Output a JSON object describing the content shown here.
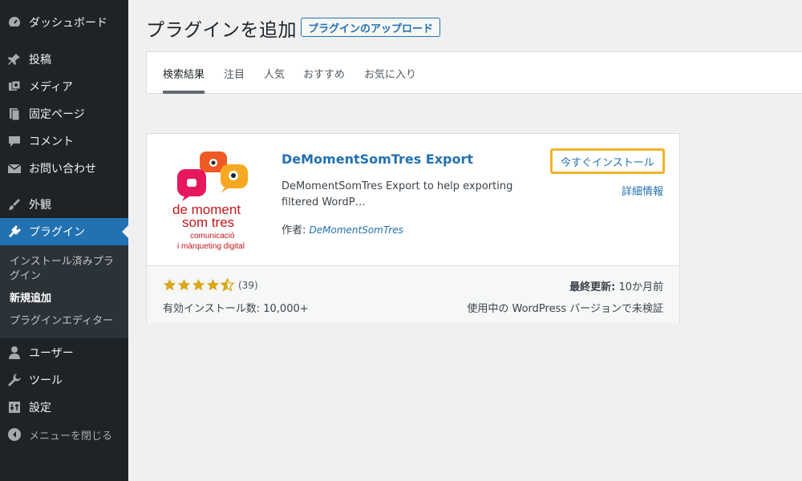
{
  "sidebar": {
    "items": [
      {
        "label": "ダッシュボード",
        "icon": "dashboard-icon"
      },
      {
        "label": "投稿",
        "icon": "pin-icon"
      },
      {
        "label": "メディア",
        "icon": "media-icon"
      },
      {
        "label": "固定ページ",
        "icon": "pages-icon"
      },
      {
        "label": "コメント",
        "icon": "comment-icon"
      },
      {
        "label": "お問い合わせ",
        "icon": "mail-icon"
      },
      {
        "label": "外観",
        "icon": "appearance-icon"
      },
      {
        "label": "プラグイン",
        "icon": "plugin-icon"
      },
      {
        "label": "ユーザー",
        "icon": "user-icon"
      },
      {
        "label": "ツール",
        "icon": "wrench-icon"
      },
      {
        "label": "設定",
        "icon": "settings-icon"
      }
    ],
    "submenu": [
      {
        "label": "インストール済みプラグイン"
      },
      {
        "label": "新規追加"
      },
      {
        "label": "プラグインエディター"
      }
    ],
    "collapse_label": "メニューを閉じる"
  },
  "header": {
    "title": "プラグインを追加",
    "upload_label": "プラグインのアップロード"
  },
  "tabs": [
    {
      "label": "検索結果"
    },
    {
      "label": "注目"
    },
    {
      "label": "人気"
    },
    {
      "label": "おすすめ"
    },
    {
      "label": "お気に入り"
    }
  ],
  "plugin": {
    "name": "DeMomentSomTres Export",
    "description": "DeMomentSomTres Export to help exporting filtered WordP…",
    "author_prefix": "作者: ",
    "author": "DeMomentSomTres",
    "install_label": "今すぐインストール",
    "details_label": "詳細情報",
    "rating": 4.5,
    "rating_count": "(39)",
    "installs": "有効インストール数: 10,000+",
    "last_updated_label": "最終更新:",
    "last_updated_value": " 10か月前",
    "compat": "使用中の WordPress バージョンで未検証",
    "logo": {
      "line1": "de moment",
      "line2": "som tres",
      "line3": "comunicació",
      "line4": "i màrqueting digital"
    },
    "colors": {
      "star": "#dba617",
      "accent": "#2271b1",
      "highlight": "#f0b429",
      "logo_red": "#c4161c"
    }
  }
}
